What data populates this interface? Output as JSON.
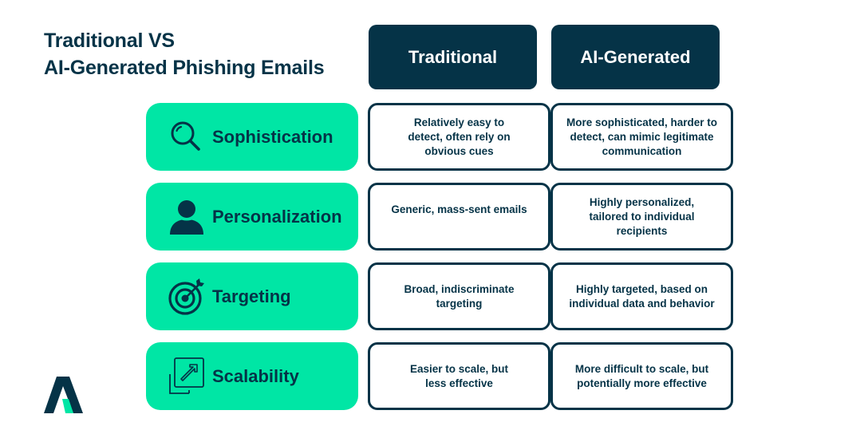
{
  "title": {
    "line1": "Traditional VS",
    "line2": "AI-Generated Phishing Emails"
  },
  "columns": {
    "traditional": "Traditional",
    "ai": "AI-Generated"
  },
  "rows": [
    {
      "label": "Sophistication",
      "icon": "magnifying-glass-icon",
      "traditional": "Relatively easy to detect, often rely on obvious cues",
      "ai": "More sophisticated, harder to detect, can mimic legitimate communication"
    },
    {
      "label": "Personalization",
      "icon": "user-icon",
      "traditional": "Generic, mass-sent emails",
      "ai": "Highly personalized, tailored to individual recipients"
    },
    {
      "label": "Targeting",
      "icon": "target-icon",
      "traditional": "Broad, indiscriminate targeting",
      "ai": "Highly targeted, based on individual data and behavior"
    },
    {
      "label": "Scalability",
      "icon": "scale-up-icon",
      "traditional": "Easier to scale, but less effective",
      "ai": "More difficult to scale, but potentially more effective"
    }
  ],
  "colors": {
    "navy": "#053347",
    "accent": "#00e6a5",
    "background": "#ffffff"
  }
}
